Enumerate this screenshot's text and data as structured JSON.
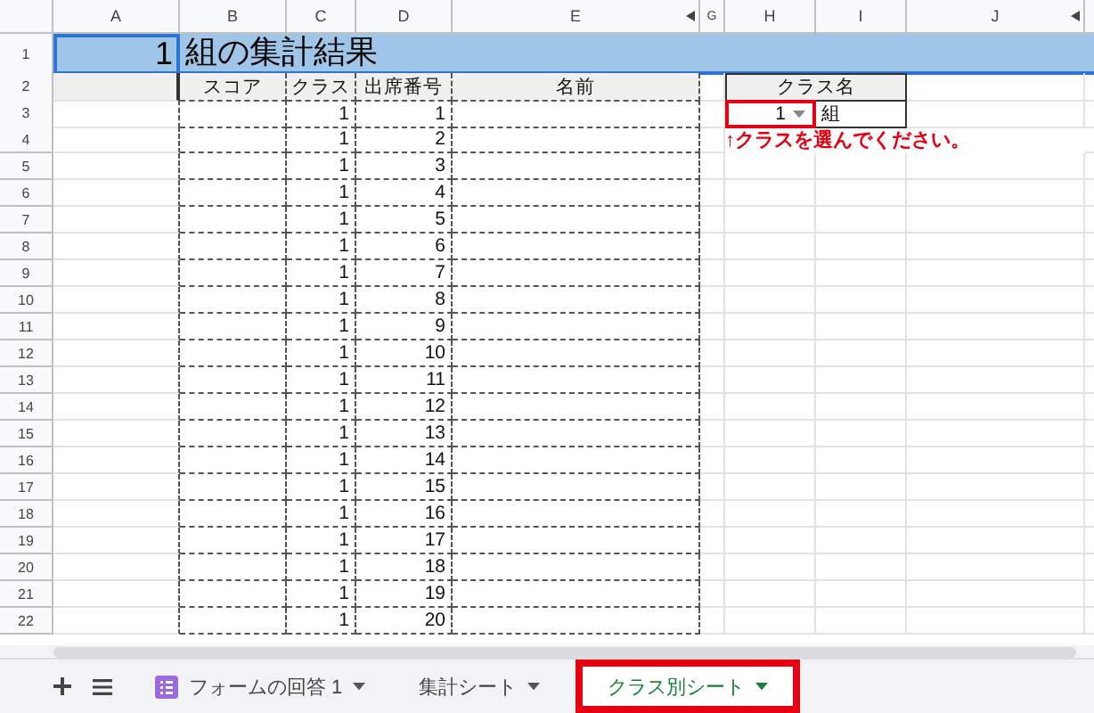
{
  "column_headers": [
    "A",
    "B",
    "C",
    "D",
    "E",
    "G",
    "H",
    "I",
    "J"
  ],
  "row_numbers": [
    "1",
    "2",
    "3",
    "4",
    "5",
    "6",
    "7",
    "8",
    "9",
    "10",
    "11",
    "12",
    "13",
    "14",
    "15",
    "16",
    "17",
    "18",
    "19",
    "20",
    "21",
    "22"
  ],
  "title": {
    "class": "1",
    "text": "組の集計結果"
  },
  "table": {
    "columns": [
      "スコア",
      "クラス",
      "出席番号",
      "名前"
    ],
    "rows": [
      {
        "class": "1",
        "number": "1"
      },
      {
        "class": "1",
        "number": "2"
      },
      {
        "class": "1",
        "number": "3"
      },
      {
        "class": "1",
        "number": "4"
      },
      {
        "class": "1",
        "number": "5"
      },
      {
        "class": "1",
        "number": "6"
      },
      {
        "class": "1",
        "number": "7"
      },
      {
        "class": "1",
        "number": "8"
      },
      {
        "class": "1",
        "number": "9"
      },
      {
        "class": "1",
        "number": "10"
      },
      {
        "class": "1",
        "number": "11"
      },
      {
        "class": "1",
        "number": "12"
      },
      {
        "class": "1",
        "number": "13"
      },
      {
        "class": "1",
        "number": "14"
      },
      {
        "class": "1",
        "number": "15"
      },
      {
        "class": "1",
        "number": "16"
      },
      {
        "class": "1",
        "number": "17"
      },
      {
        "class": "1",
        "number": "18"
      },
      {
        "class": "1",
        "number": "19"
      },
      {
        "class": "1",
        "number": "20"
      }
    ]
  },
  "class_picker": {
    "label": "クラス名",
    "value": "1",
    "suffix": "組",
    "note": "↑クラスを選んでください。"
  },
  "sheet_tabs": [
    {
      "label": "フォームの回答 1",
      "kind": "form",
      "selected": false
    },
    {
      "label": "集計シート",
      "kind": "plain",
      "selected": false
    },
    {
      "label": "クラス別シート",
      "kind": "plain",
      "selected": true
    }
  ]
}
